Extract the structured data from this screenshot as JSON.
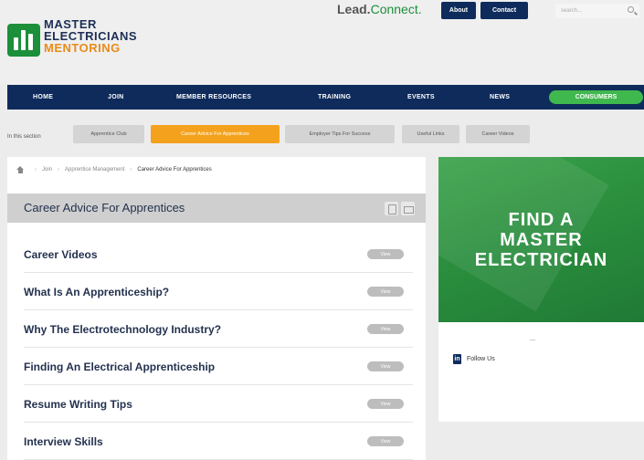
{
  "header": {
    "logo_lines": [
      "MASTER",
      "ELECTRICIANS",
      "MENTORING"
    ],
    "leadconnect_part1": "Lead.",
    "leadconnect_part2": "Connect.",
    "about_label": "About",
    "contact_label": "Contact",
    "search_placeholder": "search..."
  },
  "nav": {
    "items": [
      "HOME",
      "JOIN",
      "MEMBER RESOURCES",
      "TRAINING",
      "EVENTS",
      "NEWS"
    ],
    "consumers_label": "CONSUMERS"
  },
  "section": {
    "label": "In this section",
    "tabs": [
      "Apprentice Club",
      "Career Advice For Apprentices",
      "Employer Tips For Success",
      "Useful Links",
      "Career Videos"
    ]
  },
  "breadcrumb": [
    "Join",
    "Apprentice Management",
    "Career Advice For Apprentices"
  ],
  "main": {
    "title": "Career Advice For Apprentices",
    "items": [
      {
        "label": "Career Videos",
        "button": "View"
      },
      {
        "label": "What Is An Apprenticeship?",
        "button": "View"
      },
      {
        "label": "Why The Electrotechnology Industry?",
        "button": "View"
      },
      {
        "label": "Finding An Electrical Apprenticeship",
        "button": "View"
      },
      {
        "label": "Resume Writing Tips",
        "button": "View"
      },
      {
        "label": "Interview Skills",
        "button": "View"
      }
    ]
  },
  "sidebar": {
    "banner_lines": [
      "FIND A",
      "MASTER",
      "ELECTRICIAN"
    ],
    "follow_label": "Follow Us"
  },
  "colors": {
    "navy": "#0e2b5c",
    "green": "#3fb84e",
    "orange": "#f4a21d"
  }
}
